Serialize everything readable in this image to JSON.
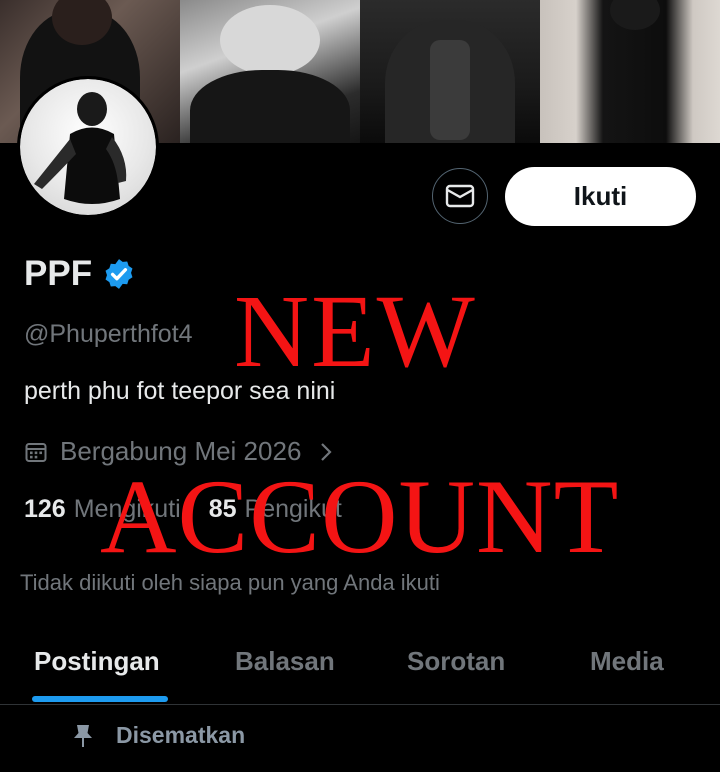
{
  "profile": {
    "display_name": "PPF",
    "handle": "@Phuperthfot4",
    "bio": "perth phu fot teepor sea nini",
    "joined": "Bergabung Mei 2026",
    "following_count": "126",
    "following_label": "Mengikuti",
    "followers_count": "85",
    "followers_label": "Pengikut",
    "not_followed_note": "Tidak diikuti oleh siapa pun yang Anda ikuti",
    "verified_color": "#1d9bf0"
  },
  "actions": {
    "follow_label": "Ikuti",
    "message_icon": "envelope-icon"
  },
  "tabs": [
    {
      "label": "Postingan",
      "active": true
    },
    {
      "label": "Balasan",
      "active": false
    },
    {
      "label": "Sorotan",
      "active": false
    },
    {
      "label": "Media",
      "active": false
    }
  ],
  "pinned": {
    "label": "Disematkan",
    "icon": "pin-icon"
  },
  "overlay": {
    "line1": "NEW",
    "line2": "ACCOUNT",
    "color": "#f41414"
  },
  "colors": {
    "background": "#000000",
    "text_primary": "#e7e9ea",
    "text_secondary": "#71767b",
    "accent": "#1d9bf0"
  }
}
